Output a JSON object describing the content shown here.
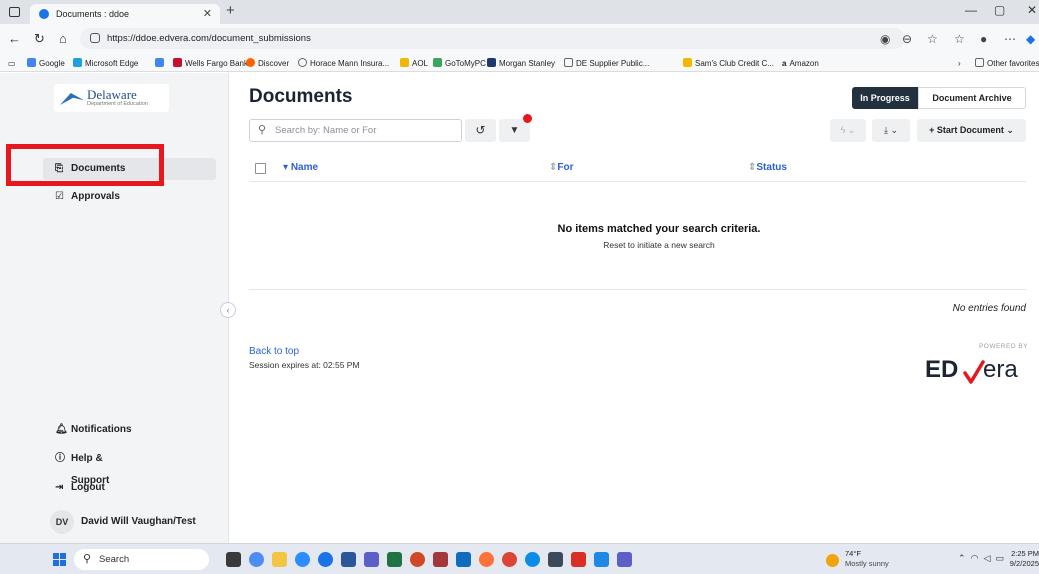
{
  "browser": {
    "tab_title": "Documents : ddoe",
    "url": "https://ddoe.edvera.com/document_submissions",
    "favorites": [
      {
        "label": "Google",
        "color": "#4285f4"
      },
      {
        "label": "Microsoft Edge",
        "color": "#1fa0e0"
      },
      {
        "label": "",
        "color": "#4285f4"
      },
      {
        "label": "Wells Fargo Bank",
        "color": "#c8102e"
      },
      {
        "label": "Discover",
        "color": "#ff6000"
      },
      {
        "label": "Horace Mann Insura...",
        "color": "#ffffff"
      },
      {
        "label": "AOL",
        "color": "#f2b705"
      },
      {
        "label": "GoToMyPC",
        "color": "#3aa65b"
      },
      {
        "label": "Morgan Stanley",
        "color": "#1c3a70"
      },
      {
        "label": "DE Supplier Public...",
        "color": "#ffffff"
      },
      {
        "label": "Sam's Club Credit C...",
        "color": "#f5b800"
      },
      {
        "label": "Amazon",
        "color": "#ffffff"
      }
    ],
    "other_favorites": "Other favorites"
  },
  "sidebar": {
    "logo_name": "Delaware",
    "logo_sub": "Department of Education",
    "items": [
      {
        "label": "Documents",
        "icon": "documents-icon"
      },
      {
        "label": "Approvals",
        "icon": "checkbox-icon"
      }
    ],
    "bottom_items": [
      {
        "label": "Notifications",
        "icon": "bell-icon"
      },
      {
        "label": "Help & Support",
        "icon": "info-icon"
      },
      {
        "label": "Logout",
        "icon": "logout-icon"
      }
    ],
    "user_initials": "DV",
    "user_name": "David Will Vaughan/Test"
  },
  "main": {
    "title": "Documents",
    "toggle": {
      "in_progress": "In Progress",
      "archive": "Document Archive",
      "active": "In Progress"
    },
    "search_placeholder": "Search by: Name or For",
    "start_button": "Start Document",
    "columns": [
      "Name",
      "For",
      "Status"
    ],
    "empty_title": "No items matched your search criteria.",
    "empty_sub": "Reset to initiate a new search",
    "no_entries": "No entries found",
    "back_to_top": "Back to top",
    "session": "Session expires at: 02:55 PM",
    "powered_by": "POWERED BY",
    "brand_left": "ED",
    "brand_right": "era",
    "colors": {
      "accent": "#2b5fd9",
      "dark": "#23313f",
      "highlight": "#e8161d",
      "brand_check": "#e8161d"
    }
  },
  "taskbar": {
    "search_label": "Search",
    "weather_temp": "74°F",
    "weather_desc": "Mostly sunny",
    "time": "2:25 PM",
    "date": "9/2/2025"
  }
}
